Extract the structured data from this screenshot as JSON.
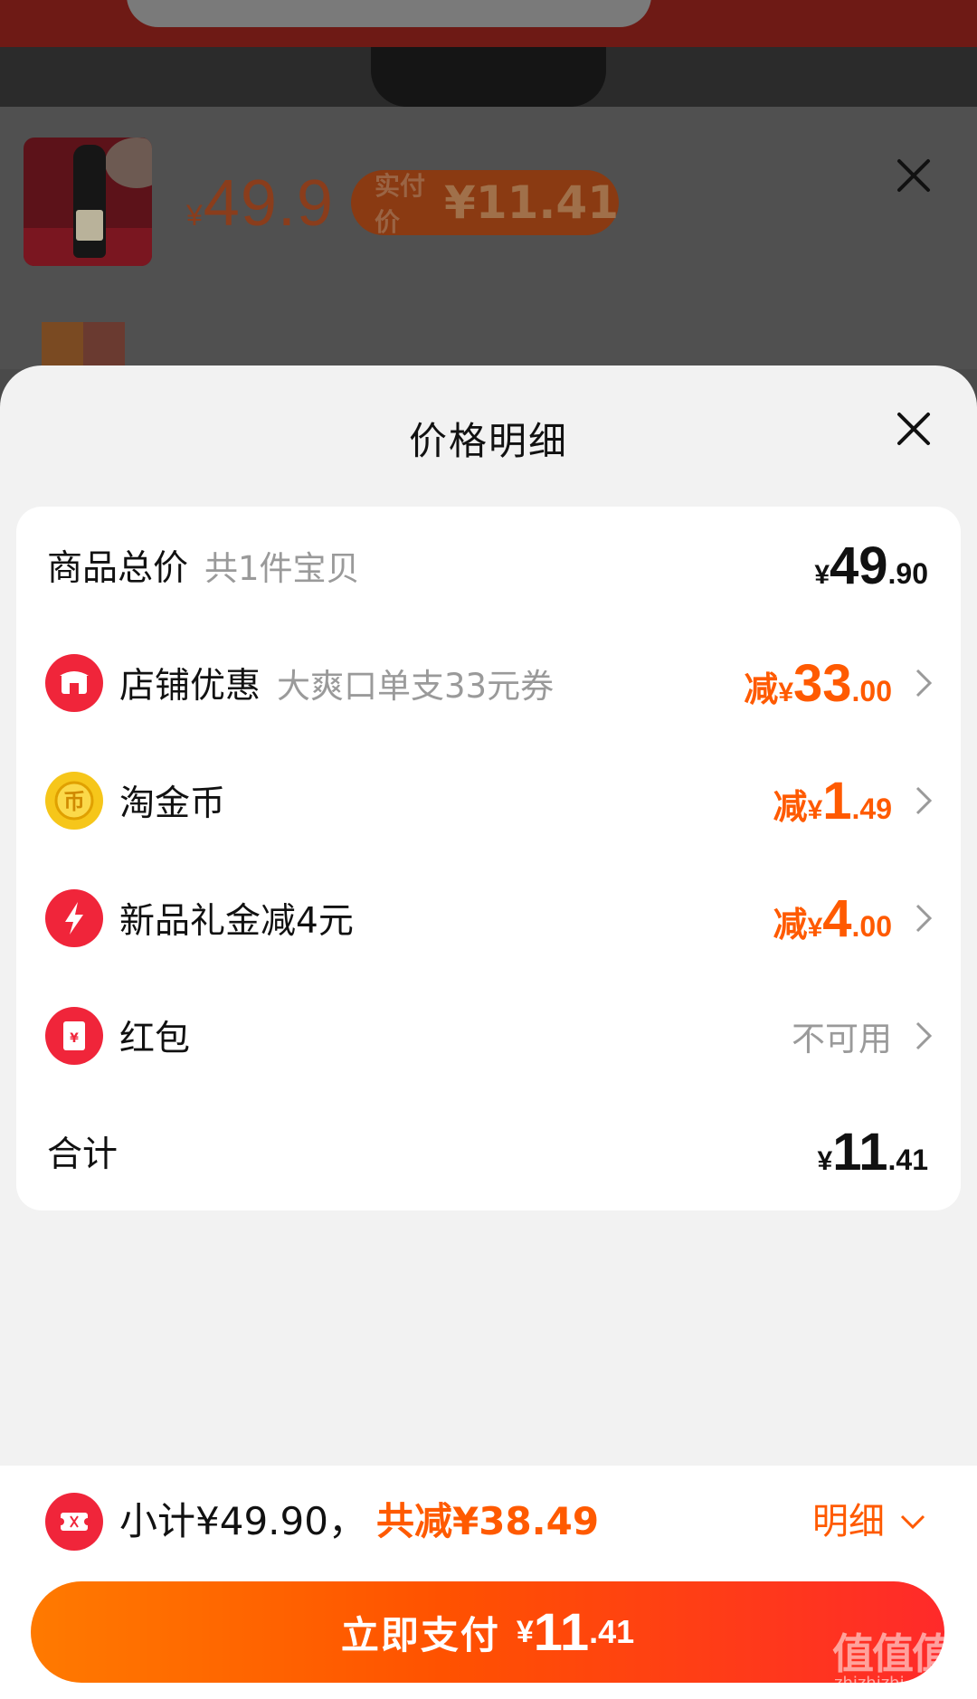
{
  "background": {
    "product_price": "49.9",
    "product_price_yen": "¥",
    "actual_pay_label": "实付价",
    "actual_pay_value": "¥11.41"
  },
  "sheet": {
    "title": "价格明细",
    "rows": [
      {
        "name": "商品总价",
        "sub": "共1件宝贝",
        "amount_yen": "¥",
        "amount_int": "49",
        "amount_dec": ".90"
      },
      {
        "name": "店铺优惠",
        "sub": "大爽口单支33元券",
        "prefix": "减",
        "amount_yen": "¥",
        "amount_int": "33",
        "amount_dec": ".00",
        "icon": "shop-icon"
      },
      {
        "name": "淘金币",
        "prefix": "减",
        "amount_yen": "¥",
        "amount_int": "1",
        "amount_dec": ".49",
        "icon": "coin-icon"
      },
      {
        "name": "新品礼金减4元",
        "prefix": "减",
        "amount_yen": "¥",
        "amount_int": "4",
        "amount_dec": ".00",
        "icon": "lightning-icon"
      },
      {
        "name": "红包",
        "status": "不可用",
        "icon": "red-envelope-icon"
      }
    ],
    "total": {
      "name": "合计",
      "amount_yen": "¥",
      "amount_int": "11",
      "amount_dec": ".41"
    }
  },
  "bottom": {
    "subtotal": "小计¥49.90，",
    "saving": "共减¥38.49",
    "detail": "明细",
    "pay_label": "立即支付",
    "pay_yen": "¥",
    "pay_int": "11",
    "pay_dec": ".41"
  },
  "watermark": {
    "text": "值值值",
    "sub": "zhizhizhi.com"
  },
  "colors": {
    "accent": "#ff5a00",
    "red": "#f0253a",
    "gold": "#f6c61a"
  }
}
